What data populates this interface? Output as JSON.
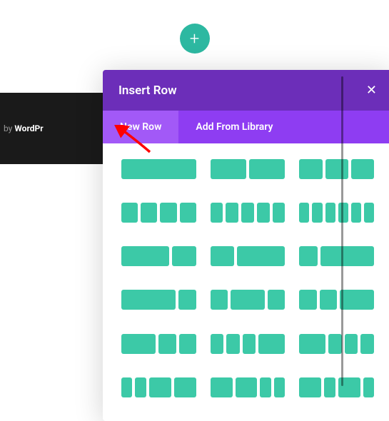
{
  "footer": {
    "prefix": "by",
    "brand": "WordPr"
  },
  "addButton": {
    "glyph": "+"
  },
  "modal": {
    "title": "Insert Row",
    "closeGlyph": "✕",
    "tabs": {
      "newRow": "New Row",
      "addFromLibrary": "Add From Library"
    }
  },
  "layouts": [
    "1",
    "1,1",
    "1,1,1",
    "1,1,1,1",
    "1,1,1,1,1",
    "1,1,1,1,1,1",
    "2,1",
    "1,2",
    "1,3",
    "3,1",
    "1,2,1",
    "1,1,2",
    "2,1,1",
    "1,1,1,2",
    "2,1,1,1",
    "1,1,2,2",
    "2,2,1,1",
    "2,1,2,1"
  ]
}
